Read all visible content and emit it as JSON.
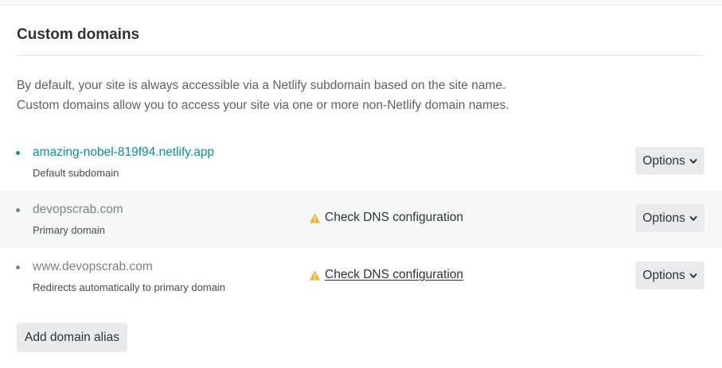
{
  "card": {
    "title": "Custom domains",
    "intro_line1": "By default, your site is always accessible via a Netlify subdomain based on the site name.",
    "intro_line2": "Custom domains allow you to access your site via one or more non-Netlify domain names."
  },
  "domains": [
    {
      "name": "amazing-nobel-819f94.netlify.app",
      "subtitle": "Default subdomain",
      "dns_warning": "",
      "options_label": "Options"
    },
    {
      "name": "devopscrab.com",
      "subtitle": "Primary domain",
      "dns_warning": "Check DNS configuration",
      "options_label": "Options"
    },
    {
      "name": "www.devopscrab.com",
      "subtitle": "Redirects automatically to primary domain",
      "dns_warning": "Check DNS configuration",
      "options_label": "Options"
    }
  ],
  "add_domain_label": "Add domain alias",
  "icons": {
    "warning": "warning-triangle-icon",
    "chevron": "chevron-down-icon"
  },
  "colors": {
    "accent_teal": "#07928f",
    "warning_yellow": "#f0b429",
    "button_bg": "#e9ebed"
  }
}
